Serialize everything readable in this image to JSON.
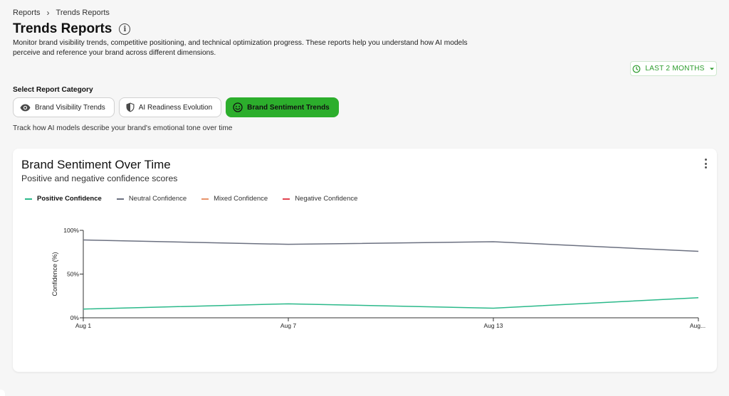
{
  "breadcrumb": {
    "parent": "Reports",
    "current": "Trends Reports"
  },
  "page": {
    "title": "Trends Reports",
    "description": "Monitor brand visibility trends, competitive positioning, and technical optimization progress. These reports help you understand how AI models perceive and reference your brand across different dimensions."
  },
  "date_range": {
    "label": "LAST 2 MONTHS",
    "icon": "clock-icon"
  },
  "categories": {
    "label": "Select Report Category",
    "items": [
      {
        "label": "Brand Visibility Trends",
        "icon": "eye-icon",
        "active": false
      },
      {
        "label": "AI Readiness Evolution",
        "icon": "shield-icon",
        "active": false
      },
      {
        "label": "Brand Sentiment Trends",
        "icon": "smile-icon",
        "active": true
      }
    ],
    "description": "Track how AI models describe your brand's emotional tone over time"
  },
  "card": {
    "title": "Brand Sentiment Over Time",
    "subtitle": "Positive and negative confidence scores"
  },
  "chart_data": {
    "type": "line",
    "ylabel": "Confidence (%)",
    "xlabel": "",
    "x": [
      "Aug 1",
      "Aug 7",
      "Aug 13",
      "Aug..."
    ],
    "ylim": [
      0,
      100
    ],
    "yticks": [
      "0%",
      "50%",
      "100%"
    ],
    "legend": "top-left",
    "series": [
      {
        "name": "Positive Confidence",
        "color": "#2bb98a",
        "values": [
          10,
          16,
          11,
          23
        ],
        "visible": true
      },
      {
        "name": "Neutral Confidence",
        "color": "#6b7080",
        "values": [
          89,
          84,
          87,
          76
        ],
        "visible": true
      },
      {
        "name": "Mixed Confidence",
        "color": "#e8936a",
        "values": [],
        "visible": false
      },
      {
        "name": "Negative Confidence",
        "color": "#e2434f",
        "values": [],
        "visible": false
      }
    ]
  }
}
